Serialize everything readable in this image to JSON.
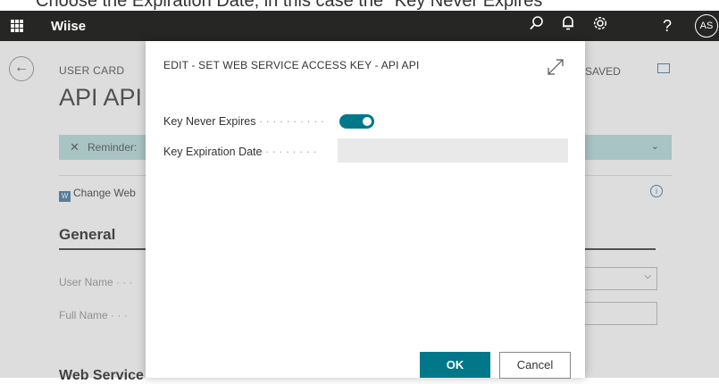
{
  "caption": "Choose the Expiration Date, in this case the \"Key Never Expires\"",
  "app": {
    "name": "Wiise",
    "avatar_initials": "AS",
    "icons": [
      "search-icon",
      "bell-icon",
      "settings-icon",
      "help-icon"
    ]
  },
  "page": {
    "breadcrumb": "USER CARD",
    "title": "API API",
    "reminder_text": "Reminder:",
    "saved_label": "SAVED",
    "action_label": "Change Web",
    "section_general": "General",
    "field_user_name": "User Name",
    "field_full_name": "Full Name",
    "bottom_section": "Web Service"
  },
  "dialog": {
    "title": "EDIT - SET WEB SERVICE ACCESS KEY - API API",
    "key_never_expires_label": "Key Never Expires",
    "key_never_expires_value": true,
    "key_expiration_label": "Key Expiration Date",
    "key_expiration_value": "",
    "ok_label": "OK",
    "cancel_label": "Cancel"
  },
  "colors": {
    "accent": "#00788a",
    "topbar": "#262624",
    "reminder_bg": "#b9dede"
  }
}
